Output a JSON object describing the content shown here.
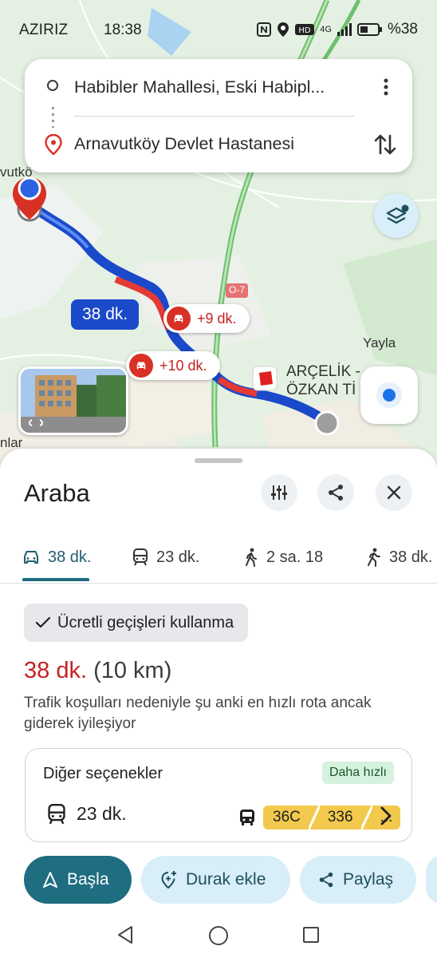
{
  "status_bar": {
    "carrier": "AZIRIZ",
    "time": "18:38",
    "network": "4G",
    "battery": "%38"
  },
  "search": {
    "origin": "Habibler Mahallesi, Eski Habipl...",
    "destination": "Arnavutköy Devlet Hastanesi"
  },
  "map": {
    "route_time": "38 dk.",
    "delay_1": "+9 dk.",
    "delay_2": "+10 dk.",
    "road_label": "O-7",
    "place_yayla": "Yayla",
    "place_arcelik_1": "ARÇELİK -",
    "place_arcelik_2": "ÖZKAN Tİ",
    "place_left_top": "vutkö",
    "place_left_bottom": "nlar",
    "route_color": "#1a49c9",
    "traffic_color": "#e53935"
  },
  "sheet": {
    "title": "Araba",
    "tabs": [
      {
        "icon": "car-icon",
        "label": "38 dk."
      },
      {
        "icon": "transit-icon",
        "label": "23 dk."
      },
      {
        "icon": "walk-icon",
        "label": "2 sa. 18"
      },
      {
        "icon": "ride-icon",
        "label": "38 dk."
      }
    ],
    "toll_chip": "Ücretli geçişleri kullanma",
    "eta_time": "38 dk.",
    "eta_distance": "(10 km)",
    "description": "Trafik koşulları nedeniyle şu anki en hızlı rota ancak giderek iyileşiyor",
    "other_options": {
      "title": "Diğer seçenekler",
      "badge": "Daha hızlı",
      "time": "23 dk.",
      "lines": [
        "36C",
        "336",
        "..."
      ]
    },
    "actions": {
      "start": "Başla",
      "add_stop": "Durak ekle",
      "share": "Paylaş"
    }
  }
}
